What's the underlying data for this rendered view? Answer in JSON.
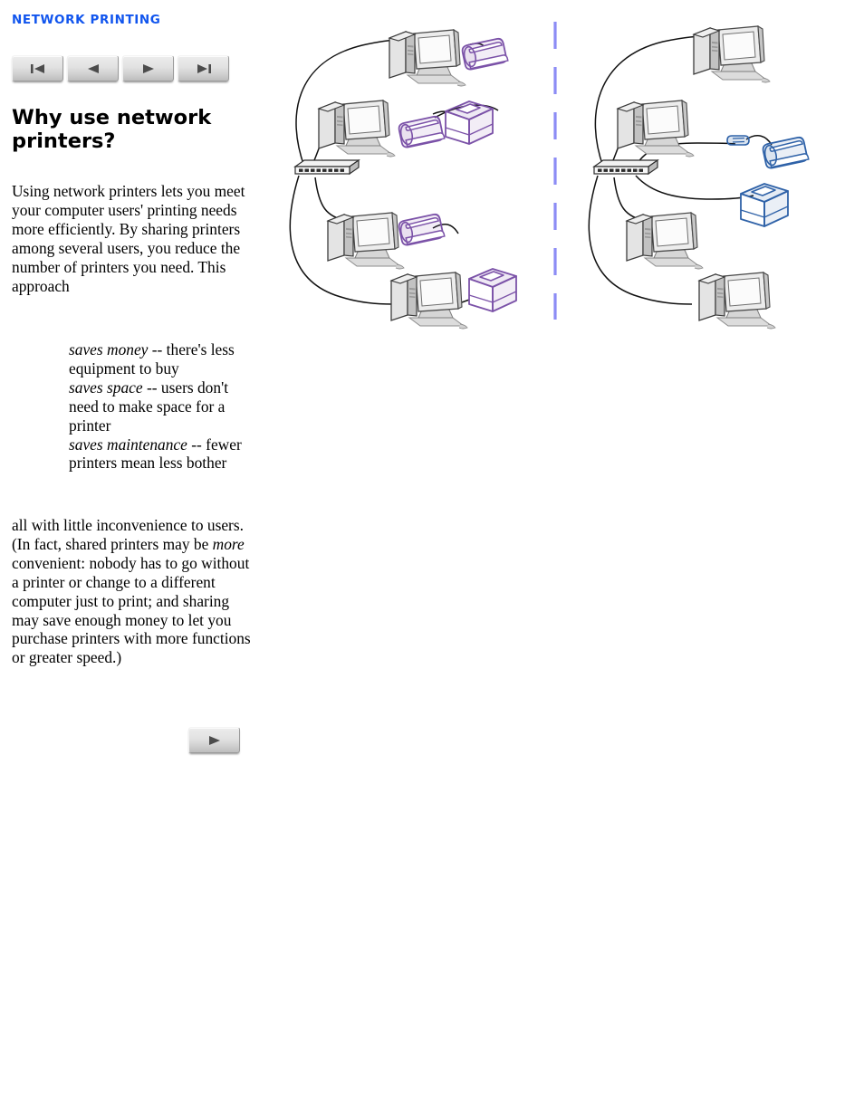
{
  "kicker": "NETWORK PRINTING",
  "nav": {
    "buttons": [
      {
        "name": "first-page-button",
        "icon": "first-page-icon",
        "label": "First page"
      },
      {
        "name": "previous-page-button",
        "icon": "previous-page-icon",
        "label": "Previous page"
      },
      {
        "name": "next-page-button",
        "icon": "next-page-icon",
        "label": "Next page"
      },
      {
        "name": "last-page-button",
        "icon": "last-page-icon",
        "label": "Last page"
      }
    ],
    "bottom_next_label": "Next page"
  },
  "title": "Why use network printers?",
  "intro_paragraph": "Using network printers lets you meet your computer users' printing needs more efficiently. By sharing printers among several users, you reduce the number of printers you need. This approach",
  "benefits": [
    {
      "term": "saves money",
      "detail": " -- there's less equipment to buy"
    },
    {
      "term": "saves space",
      "detail": " -- users don't need to make space for a printer"
    },
    {
      "term": "saves maintenance",
      "detail": " -- fewer printers mean less bother"
    }
  ],
  "closing_paragraph": {
    "part1": "all with little inconvenience to users. (In fact, shared printers may be ",
    "emphasis": "more",
    "part2": " convenient: nobody has to go without a printer or change to a different computer just to print; and sharing may save enough money to let you purchase printers with more functions or greater speed.)"
  },
  "diagram": {
    "name": "network-printing-comparison-diagram",
    "colors": {
      "accent_blue": "#1155ee",
      "divider": "#8c8cf5",
      "purple_printer": "#7b52a8",
      "purple_printer_fill": "#f2edf7",
      "blue_printer": "#2f62a8",
      "blue_printer_fill": "#e8f0fa",
      "device_outline": "#3a3a3a",
      "device_fill": "#f0f0f0",
      "device_shade": "#c9c9c9",
      "cable": "#1a1a1a"
    },
    "panels": [
      {
        "name": "local-printers-panel",
        "nodes": [
          {
            "type": "hub",
            "name": "network-hub"
          },
          {
            "type": "computer",
            "name": "workstation-1"
          },
          {
            "type": "computer",
            "name": "workstation-2"
          },
          {
            "type": "computer",
            "name": "workstation-3"
          },
          {
            "type": "computer",
            "name": "workstation-4"
          },
          {
            "type": "inkjet-printer",
            "name": "local-inkjet-printer-1"
          },
          {
            "type": "inkjet-printer",
            "name": "local-inkjet-printer-2"
          },
          {
            "type": "inkjet-printer",
            "name": "local-inkjet-printer-3"
          },
          {
            "type": "laser-printer",
            "name": "local-laser-printer-1"
          },
          {
            "type": "laser-printer",
            "name": "local-laser-printer-2"
          }
        ]
      },
      {
        "name": "network-printers-panel",
        "nodes": [
          {
            "type": "hub",
            "name": "network-hub"
          },
          {
            "type": "computer",
            "name": "workstation-1"
          },
          {
            "type": "computer",
            "name": "workstation-2"
          },
          {
            "type": "computer",
            "name": "workstation-3"
          },
          {
            "type": "computer",
            "name": "workstation-4"
          },
          {
            "type": "print-server",
            "name": "external-print-server"
          },
          {
            "type": "inkjet-printer",
            "name": "shared-inkjet-printer"
          },
          {
            "type": "laser-printer",
            "name": "shared-laser-printer"
          }
        ]
      }
    ]
  }
}
